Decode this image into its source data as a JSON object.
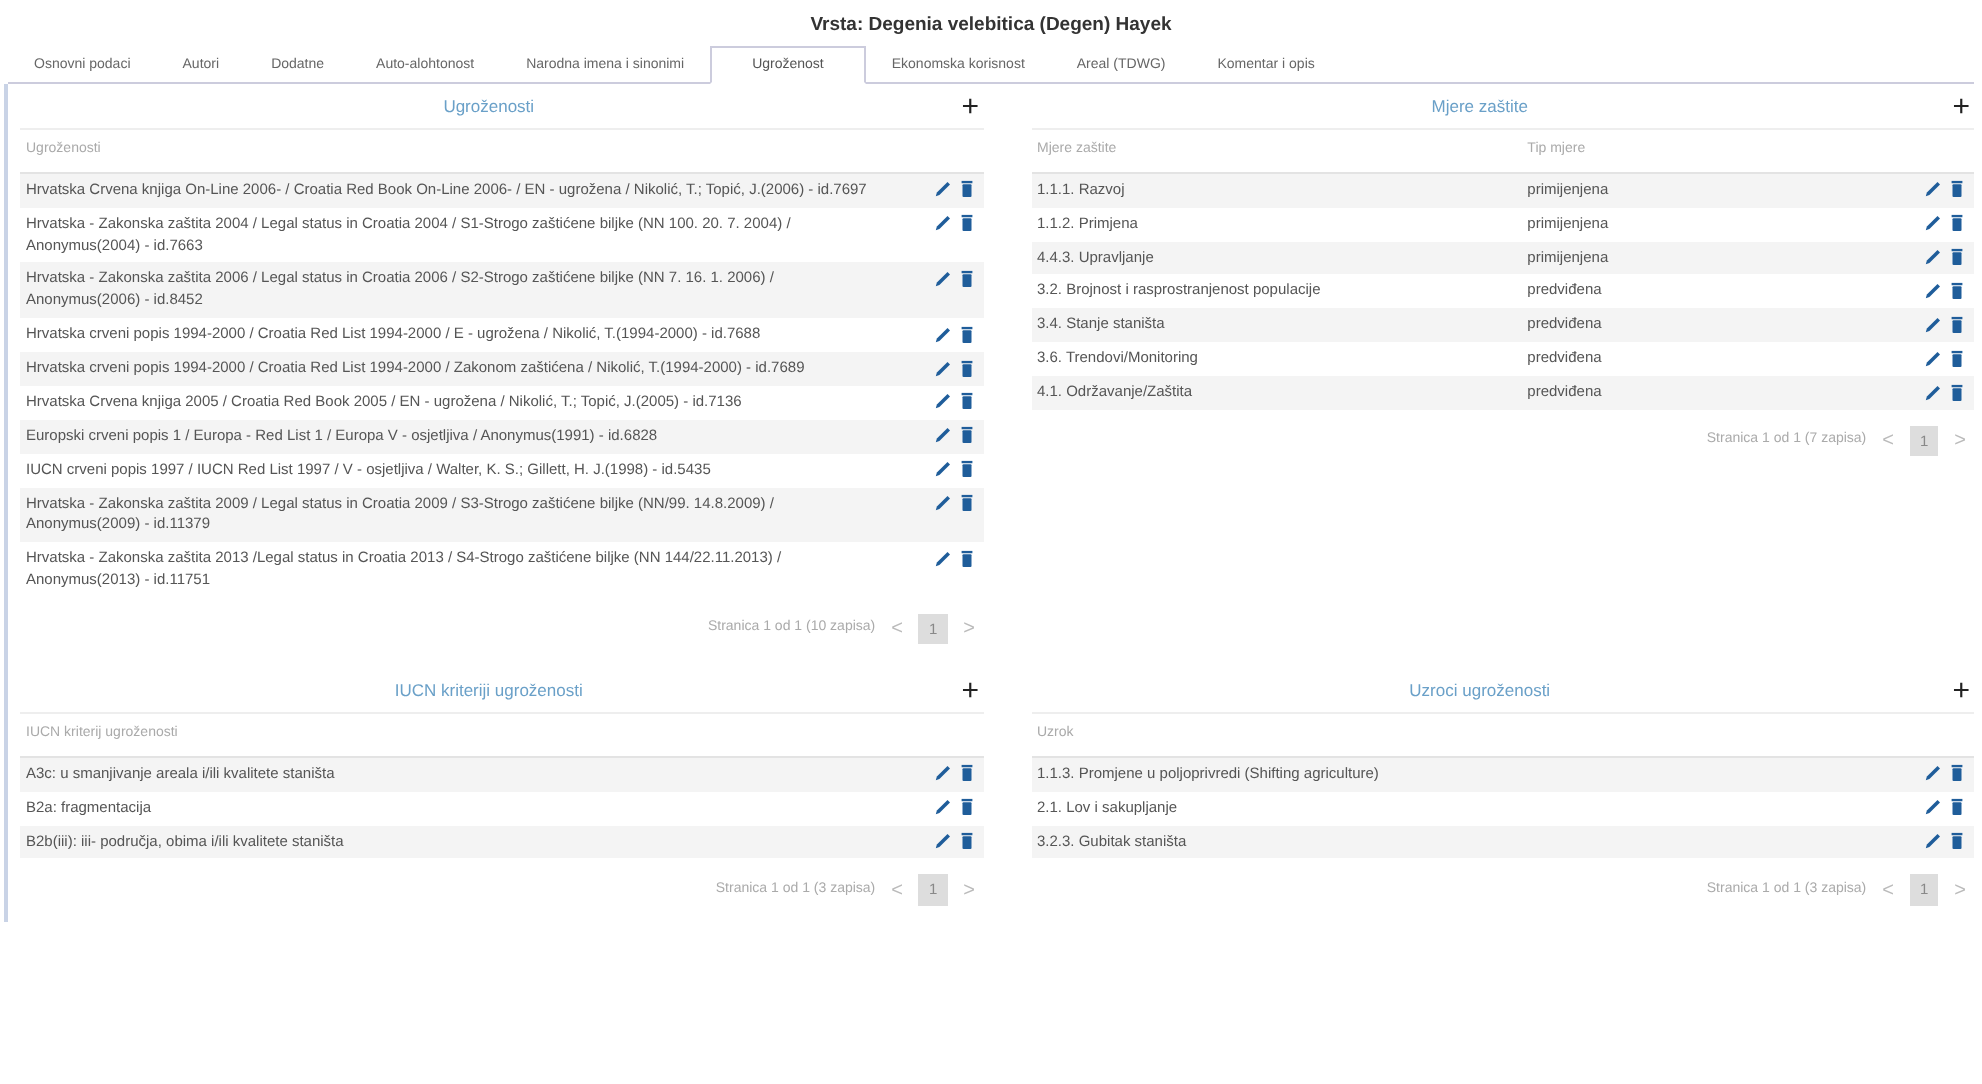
{
  "title": "Vrsta: Degenia velebitica (Degen) Hayek",
  "tabs": [
    {
      "label": "Osnovni podaci",
      "selected": false
    },
    {
      "label": "Autori",
      "selected": false
    },
    {
      "label": "Dodatne",
      "selected": false
    },
    {
      "label": "Auto-alohtonost",
      "selected": false
    },
    {
      "label": "Narodna imena i sinonimi",
      "selected": false
    },
    {
      "label": "Ugroženost",
      "selected": true
    },
    {
      "label": "Ekonomska korisnost",
      "selected": false
    },
    {
      "label": "Areal (TDWG)",
      "selected": false
    },
    {
      "label": "Komentar i opis",
      "selected": false
    }
  ],
  "panels": [
    {
      "title": "Ugroženosti",
      "add": "+",
      "columns": [
        "Ugroženosti"
      ],
      "rows": [
        {
          "cells": [
            "Hrvatska Crvena knjiga On-Line 2006- / Croatia Red Book On-Line 2006- / EN - ugrožena / Nikolić, T.; Topić, J.(2006) - id.7697"
          ]
        },
        {
          "cells": [
            "Hrvatska - Zakonska zaštita 2004 / Legal status in Croatia 2004 / S1-Strogo zaštićene biljke (NN 100. 20. 7. 2004) / Anonymus(2004) - id.7663"
          ]
        },
        {
          "cells": [
            "Hrvatska - Zakonska zaštita 2006 / Legal status in Croatia 2006 / S2-Strogo zaštićene biljke (NN 7. 16. 1. 2006) / Anonymus(2006) - id.8452"
          ]
        },
        {
          "cells": [
            "Hrvatska crveni popis 1994-2000 / Croatia Red List 1994-2000 / E - ugrožena / Nikolić, T.(1994-2000) - id.7688"
          ]
        },
        {
          "cells": [
            "Hrvatska crveni popis 1994-2000 / Croatia Red List 1994-2000 / Zakonom zaštićena / Nikolić, T.(1994-2000) - id.7689"
          ]
        },
        {
          "cells": [
            "Hrvatska Crvena knjiga 2005 / Croatia Red Book 2005 / EN - ugrožena / Nikolić, T.; Topić, J.(2005) - id.7136"
          ]
        },
        {
          "cells": [
            "Europski crveni popis 1 / Europa - Red List 1 / Europa V - osjetljiva / Anonymus(1991) - id.6828"
          ]
        },
        {
          "cells": [
            "IUCN crveni popis 1997 / IUCN Red List 1997 / V - osjetljiva / Walter, K. S.; Gillett, H. J.(1998) - id.5435"
          ]
        },
        {
          "cells": [
            "Hrvatska - Zakonska zaštita 2009 / Legal status in Croatia 2009 / S3-Strogo zaštićene biljke (NN/99. 14.8.2009) / Anonymus(2009) - id.11379"
          ]
        },
        {
          "cells": [
            "Hrvatska - Zakonska zaštita 2013 /Legal status in Croatia 2013 / S4-Strogo zaštićene biljke (NN 144/22.11.2013) / Anonymus(2013) - id.11751"
          ]
        }
      ],
      "pagination": {
        "text": "Stranica 1 od 1 (10 zapisa)",
        "prev": "<",
        "page": "1",
        "next": ">"
      }
    },
    {
      "title": "Mjere zaštite",
      "add": "+",
      "columns": [
        "Mjere zaštite",
        "Tip mjere"
      ],
      "rows": [
        {
          "cells": [
            "1.1.1. Razvoj",
            "primijenjena"
          ]
        },
        {
          "cells": [
            "1.1.2. Primjena",
            "primijenjena"
          ]
        },
        {
          "cells": [
            "4.4.3. Upravljanje",
            "primijenjena"
          ]
        },
        {
          "cells": [
            "3.2. Brojnost i rasprostranjenost populacije",
            "predviđena"
          ]
        },
        {
          "cells": [
            "3.4. Stanje staništa",
            "predviđena"
          ]
        },
        {
          "cells": [
            "3.6. Trendovi/Monitoring",
            "predviđena"
          ]
        },
        {
          "cells": [
            "4.1. Održavanje/Zaštita",
            "predviđena"
          ]
        }
      ],
      "pagination": {
        "text": "Stranica 1 od 1 (7 zapisa)",
        "prev": "<",
        "page": "1",
        "next": ">"
      }
    },
    {
      "title": "IUCN kriteriji ugroženosti",
      "add": "+",
      "columns": [
        "IUCN kriterij ugroženosti"
      ],
      "rows": [
        {
          "cells": [
            "A3c: u smanjivanje areala i/ili kvalitete staništa"
          ]
        },
        {
          "cells": [
            "B2a: fragmentacija"
          ]
        },
        {
          "cells": [
            "B2b(iii): iii- područja, obima i/ili kvalitete staništa"
          ]
        }
      ],
      "pagination": {
        "text": "Stranica 1 od 1 (3 zapisa)",
        "prev": "<",
        "page": "1",
        "next": ">"
      }
    },
    {
      "title": "Uzroci ugroženosti",
      "add": "+",
      "columns": [
        "Uzrok"
      ],
      "rows": [
        {
          "cells": [
            "1.1.3. Promjene u poljoprivredi (Shifting agriculture)"
          ]
        },
        {
          "cells": [
            "2.1. Lov i sakupljanje"
          ]
        },
        {
          "cells": [
            "3.2.3. Gubitak staništa"
          ]
        }
      ],
      "pagination": {
        "text": "Stranica 1 od 1 (3 zapisa)",
        "prev": "<",
        "page": "1",
        "next": ">"
      }
    }
  ]
}
